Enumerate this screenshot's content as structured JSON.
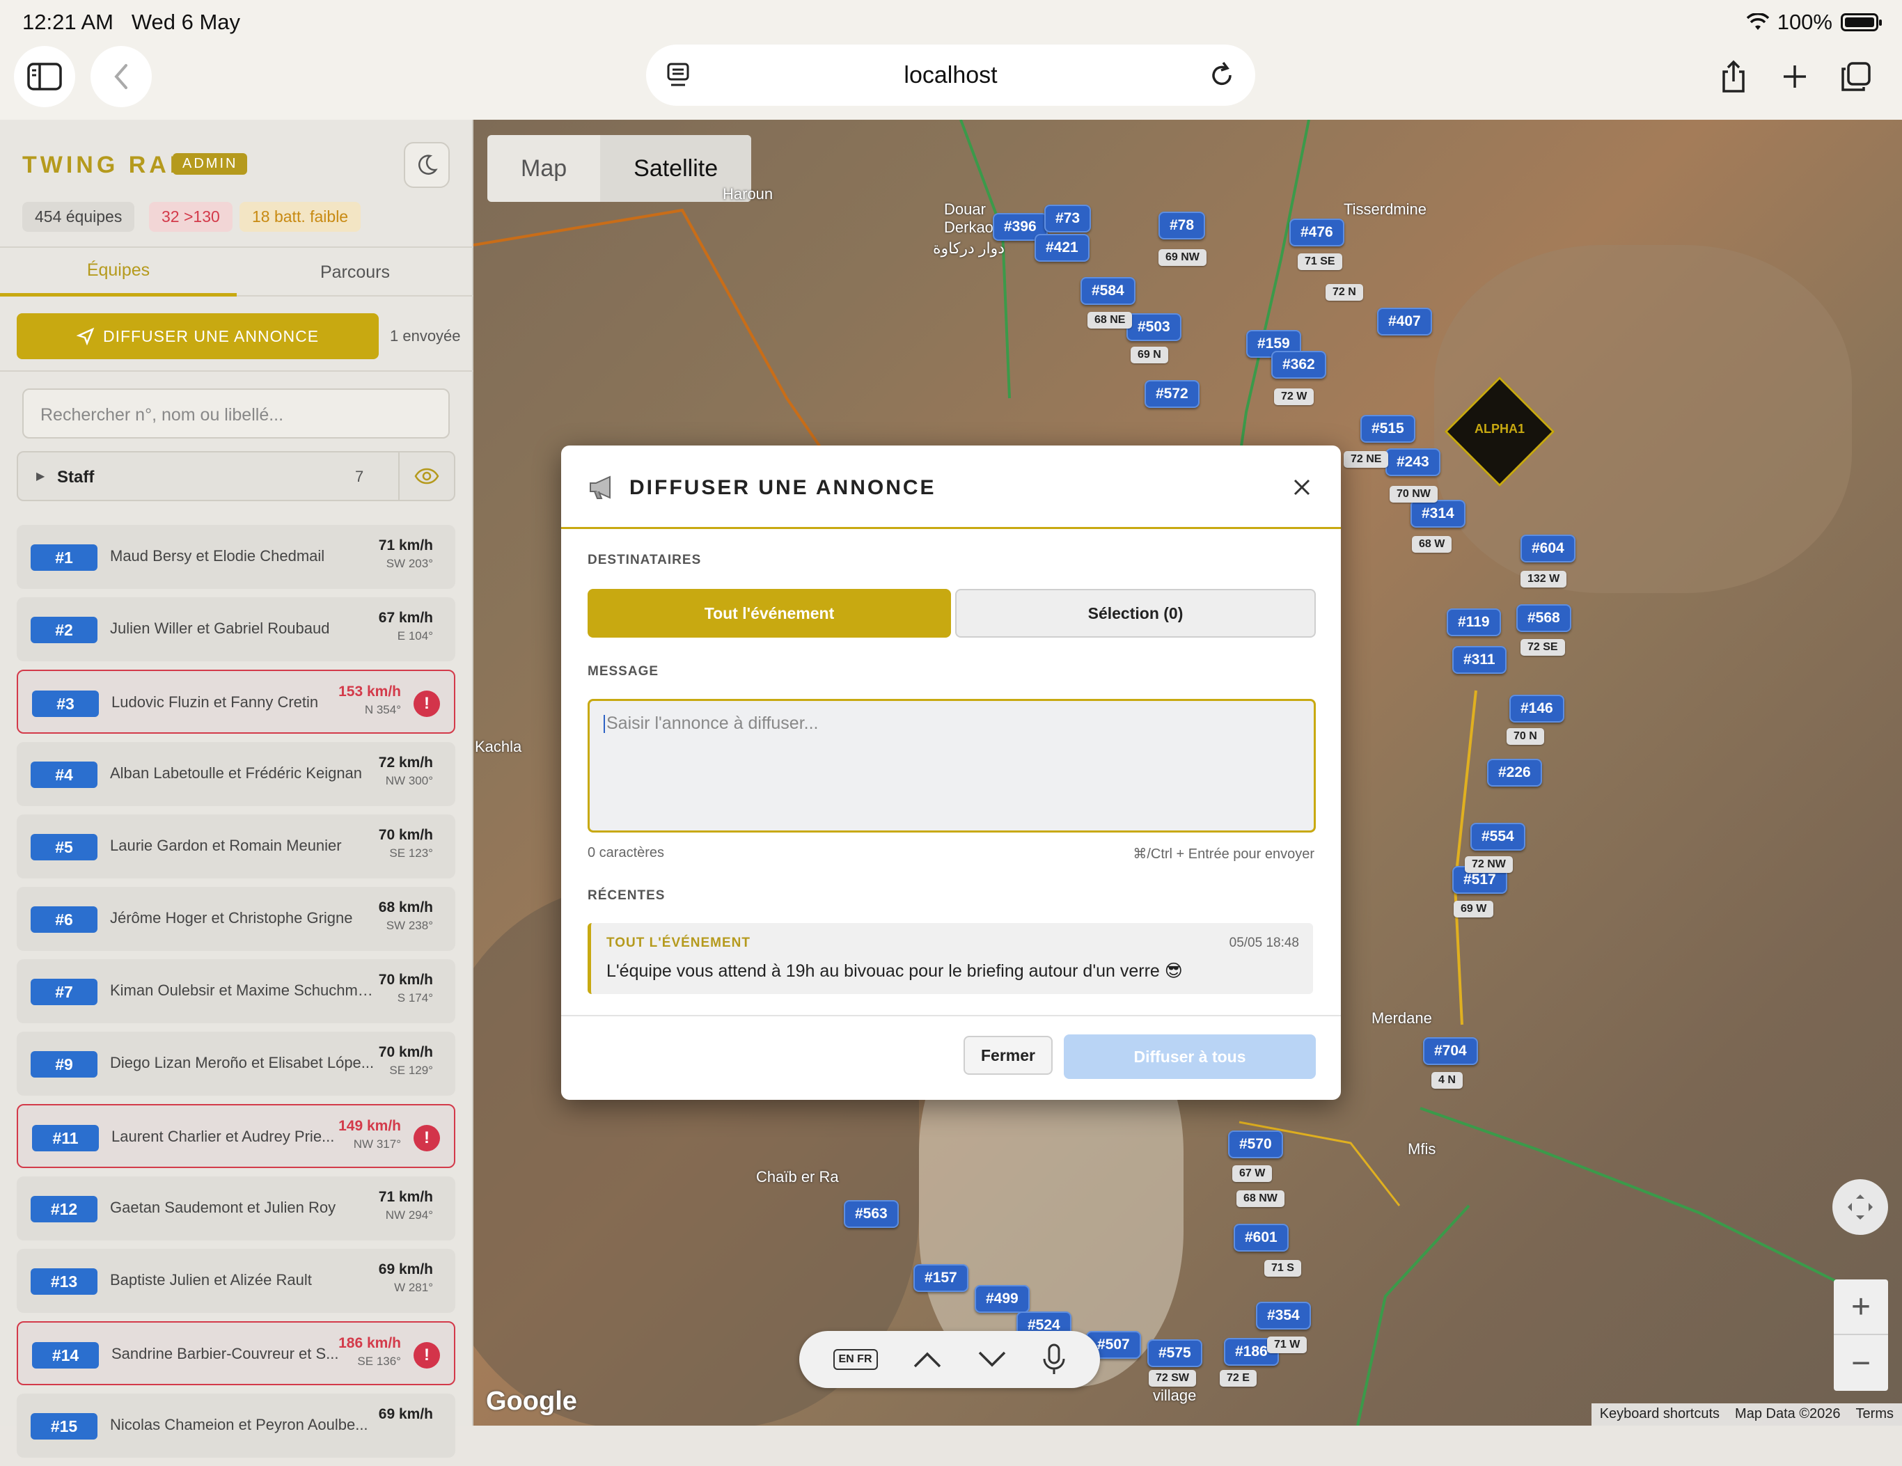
{
  "status": {
    "time": "12:21 AM",
    "date": "Wed 6 May",
    "battery": "100%"
  },
  "browser": {
    "url": "localhost"
  },
  "sidebar": {
    "brand": "TWING RAID",
    "role": "ADMIN",
    "stats": [
      "454 équipes",
      "32 >130",
      "18 batt. faible"
    ],
    "tabs": [
      "Équipes",
      "Parcours"
    ],
    "broadcast_label": "DIFFUSER UNE ANNONCE",
    "sent_count": "1 envoyée",
    "search_placeholder": "Rechercher n°, nom ou libellé...",
    "staff": {
      "label": "Staff",
      "count": "7"
    },
    "teams": [
      {
        "num": "#1",
        "name": "Maud Bersy et Elodie Chedmail",
        "speed": "71 km/h",
        "dir": "SW 203°",
        "alert": false
      },
      {
        "num": "#2",
        "name": "Julien Willer et Gabriel Roubaud",
        "speed": "67 km/h",
        "dir": "E 104°",
        "alert": false
      },
      {
        "num": "#3",
        "name": "Ludovic Fluzin et Fanny Cretin",
        "speed": "153 km/h",
        "dir": "N 354°",
        "alert": true
      },
      {
        "num": "#4",
        "name": "Alban Labetoulle et Frédéric Keignan",
        "speed": "72 km/h",
        "dir": "NW 300°",
        "alert": false
      },
      {
        "num": "#5",
        "name": "Laurie Gardon et Romain Meunier",
        "speed": "70 km/h",
        "dir": "SE 123°",
        "alert": false
      },
      {
        "num": "#6",
        "name": "Jérôme Hoger et Christophe Grigne",
        "speed": "68 km/h",
        "dir": "SW 238°",
        "alert": false
      },
      {
        "num": "#7",
        "name": "Kiman Oulebsir et Maxime Schuchma...",
        "speed": "70 km/h",
        "dir": "S 174°",
        "alert": false
      },
      {
        "num": "#9",
        "name": "Diego Lizan Meroño et Elisabet Lópe...",
        "speed": "70 km/h",
        "dir": "SE 129°",
        "alert": false
      },
      {
        "num": "#11",
        "name": "Laurent Charlier et Audrey Prie...",
        "speed": "149 km/h",
        "dir": "NW 317°",
        "alert": true
      },
      {
        "num": "#12",
        "name": "Gaetan Saudemont et Julien Roy",
        "speed": "71 km/h",
        "dir": "NW 294°",
        "alert": false
      },
      {
        "num": "#13",
        "name": "Baptiste Julien et Alizée Rault",
        "speed": "69 km/h",
        "dir": "W 281°",
        "alert": false
      },
      {
        "num": "#14",
        "name": "Sandrine Barbier-Couvreur et S...",
        "speed": "186 km/h",
        "dir": "SE 136°",
        "alert": true
      },
      {
        "num": "#15",
        "name": "Nicolas Chameion et Peyron Aoulbe...",
        "speed": "69 km/h",
        "dir": "",
        "alert": false
      }
    ]
  },
  "map": {
    "toggle": [
      "Map",
      "Satellite"
    ],
    "places": [
      "Haroun",
      "Douar Derkaoua",
      "دوار دركاوة",
      "Tisserdmine",
      "Kachla",
      "Merdane",
      "Mfis",
      "Chaïb er Ra",
      "village"
    ],
    "markers": [
      "#396",
      "#73",
      "#421",
      "#78",
      "#476",
      "#584",
      "#503",
      "#159",
      "#362",
      "#572",
      "#515",
      "#243",
      "#314",
      "#604",
      "#568",
      "#119",
      "#311",
      "#146",
      "#554",
      "#517",
      "#704",
      "#570",
      "#563",
      "#601",
      "#157",
      "#499",
      "#524",
      "#354",
      "#507",
      "#575",
      "#186",
      "#226",
      "#407"
    ],
    "sub_labels": [
      "69 NW",
      "71 SE",
      "72 N",
      "68 NE",
      "69 N",
      "72 W",
      "72 NE",
      "70 NW",
      "68 W",
      "132 W",
      "72 SE",
      "70 N",
      "72 NW",
      "69 W",
      "4 N",
      "67 W",
      "68 NW",
      "71 S",
      "71 W",
      "72 SW",
      "72 E"
    ],
    "alpha_label": "ALPHA1",
    "google": "Google",
    "attribution": [
      "Keyboard shortcuts",
      "Map Data ©2026",
      "Terms"
    ]
  },
  "keyboard": {
    "lang": "EN FR"
  },
  "modal": {
    "title": "DIFFUSER UNE ANNONCE",
    "recipients_label": "DESTINATAIRES",
    "opt_all": "Tout l'événement",
    "opt_sel": "Sélection (0)",
    "message_label": "MESSAGE",
    "placeholder": "Saisir l'annonce à diffuser...",
    "chars": "0 caractères",
    "hint": "⌘/Ctrl + Entrée pour envoyer",
    "recent_label": "RÉCENTES",
    "recent": {
      "who": "TOUT L'ÉVÉNEMENT",
      "when": "05/05 18:48",
      "msg": "L'équipe vous attend à 19h au bivouac pour le briefing autour d'un verre 😎"
    },
    "close": "Fermer",
    "send": "Diffuser à tous"
  },
  "colors": {
    "accent": "#c8a911",
    "marker": "#2d62c5",
    "alert": "#d33a4a"
  }
}
